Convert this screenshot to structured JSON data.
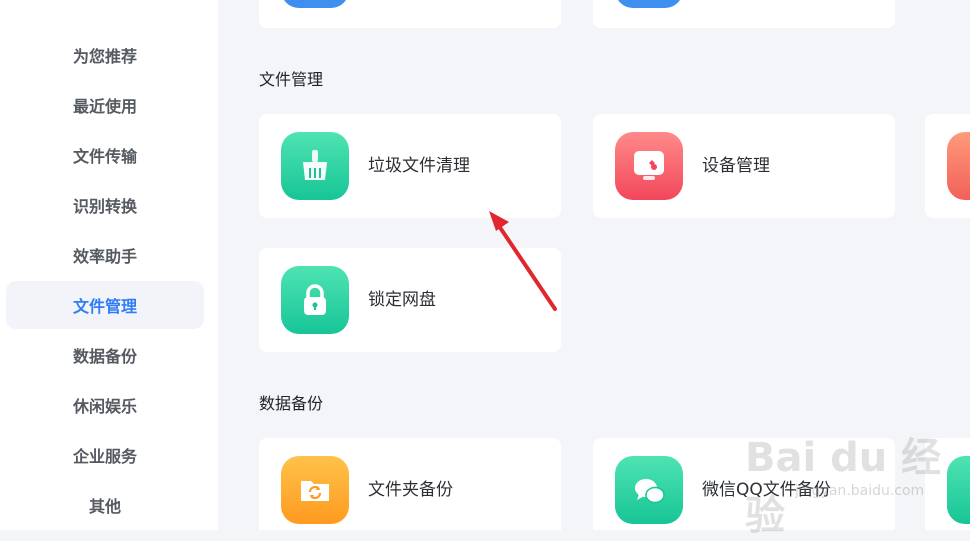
{
  "sidebar": {
    "items": [
      {
        "label": "为您推荐"
      },
      {
        "label": "最近使用"
      },
      {
        "label": "文件传输"
      },
      {
        "label": "识别转换"
      },
      {
        "label": "效率助手"
      },
      {
        "label": "文件管理",
        "active": true
      },
      {
        "label": "数据备份"
      },
      {
        "label": "休闲娱乐"
      },
      {
        "label": "企业服务"
      },
      {
        "label": "其他"
      }
    ]
  },
  "sections": {
    "file_management": {
      "title": "文件管理",
      "cards": [
        {
          "label": "垃圾文件清理",
          "icon": "broom-icon",
          "color": "#1fcb9c"
        },
        {
          "label": "设备管理",
          "icon": "wrench-monitor-icon",
          "color": "#f45667"
        },
        {
          "label": "锁定网盘",
          "icon": "lock-icon",
          "color": "#1fcb9c"
        }
      ]
    },
    "data_backup": {
      "title": "数据备份",
      "cards": [
        {
          "label": "文件夹备份",
          "icon": "folder-sync-icon",
          "color": "#ffa52a"
        },
        {
          "label": "微信QQ文件备份",
          "icon": "chat-bubbles-icon",
          "color": "#1fcb9c"
        }
      ]
    }
  },
  "watermark": {
    "text": "Bai du 经验",
    "url": "jingyan.baidu.com"
  },
  "annotation": {
    "color": "#e0262f"
  }
}
